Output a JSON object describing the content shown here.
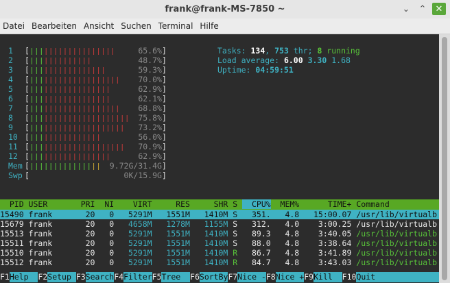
{
  "window": {
    "title": "frank@frank-MS-7850 ~",
    "buttons": {
      "minimize": "⌄",
      "maximize": "⌃",
      "close": "✕"
    }
  },
  "menu": [
    "Datei",
    "Bearbeiten",
    "Ansicht",
    "Suchen",
    "Terminal",
    "Hilfe"
  ],
  "cpus": [
    {
      "id": "1",
      "pct": "65.6%",
      "load": 0.656
    },
    {
      "id": "2",
      "pct": "48.7%",
      "load": 0.487
    },
    {
      "id": "3",
      "pct": "59.3%",
      "load": 0.593
    },
    {
      "id": "4",
      "pct": "70.0%",
      "load": 0.7
    },
    {
      "id": "5",
      "pct": "62.9%",
      "load": 0.629
    },
    {
      "id": "6",
      "pct": "62.1%",
      "load": 0.621
    },
    {
      "id": "7",
      "pct": "68.8%",
      "load": 0.688
    },
    {
      "id": "8",
      "pct": "75.8%",
      "load": 0.758
    },
    {
      "id": "9",
      "pct": "73.2%",
      "load": 0.732
    },
    {
      "id": "10",
      "pct": "56.0%",
      "load": 0.56
    },
    {
      "id": "11",
      "pct": "70.9%",
      "load": 0.709
    },
    {
      "id": "12",
      "pct": "62.9%",
      "load": 0.629
    }
  ],
  "mem": {
    "label": "Mem",
    "value": "9.72G/31.4G",
    "load": 0.55
  },
  "swp": {
    "label": "Swp",
    "value": "0K/15.9G",
    "load": 0
  },
  "summary": {
    "tasks_label": "Tasks: ",
    "tasks": "134",
    "threads": "753",
    "thr_label": " thr; ",
    "running": "8",
    "running_label": " running",
    "load_label": "Load average: ",
    "load1": "6.00",
    "load5": "3.30",
    "load15": "1.68",
    "uptime_label": "Uptime: ",
    "uptime": "04:59:51"
  },
  "columns": [
    "PID",
    "USER",
    "PRI",
    "NI",
    "VIRT",
    "RES",
    "SHR",
    "S",
    "CPU%",
    "MEM%",
    "TIME+",
    "Command"
  ],
  "processes": [
    {
      "pid": "15490",
      "user": "frank",
      "pri": "20",
      "ni": "0",
      "virt": "5291M",
      "res": "1551M",
      "shr": "1410M",
      "s": "S",
      "cpu": "351.",
      "mem": "4.8",
      "time": "15:00.07",
      "cmd": "/usr/lib/virtualb",
      "selected": true
    },
    {
      "pid": "15679",
      "user": "frank",
      "pri": "20",
      "ni": "0",
      "virt": "4658M",
      "res": "1278M",
      "shr": "1155M",
      "s": "S",
      "cpu": "312.",
      "mem": "4.0",
      "time": "3:00.25",
      "cmd": "/usr/lib/virtualb",
      "selected": false
    },
    {
      "pid": "15513",
      "user": "frank",
      "pri": "20",
      "ni": "0",
      "virt": "5291M",
      "res": "1551M",
      "shr": "1410M",
      "s": "S",
      "cpu": "89.3",
      "mem": "4.8",
      "time": "3:40.05",
      "cmd": "/usr/lib/virtualb",
      "selected": false
    },
    {
      "pid": "15511",
      "user": "frank",
      "pri": "20",
      "ni": "0",
      "virt": "5291M",
      "res": "1551M",
      "shr": "1410M",
      "s": "S",
      "cpu": "88.0",
      "mem": "4.8",
      "time": "3:38.64",
      "cmd": "/usr/lib/virtualb",
      "selected": false
    },
    {
      "pid": "15510",
      "user": "frank",
      "pri": "20",
      "ni": "0",
      "virt": "5291M",
      "res": "1551M",
      "shr": "1410M",
      "s": "R",
      "cpu": "86.7",
      "mem": "4.8",
      "time": "3:41.89",
      "cmd": "/usr/lib/virtualb",
      "selected": false
    },
    {
      "pid": "15512",
      "user": "frank",
      "pri": "20",
      "ni": "0",
      "virt": "5291M",
      "res": "1551M",
      "shr": "1410M",
      "s": "R",
      "cpu": "84.7",
      "mem": "4.8",
      "time": "3:43.03",
      "cmd": "/usr/lib/virtualb",
      "selected": false
    }
  ],
  "fkeys": [
    {
      "key": "F1",
      "label": "Help  "
    },
    {
      "key": "F2",
      "label": "Setup "
    },
    {
      "key": "F3",
      "label": "Search"
    },
    {
      "key": "F4",
      "label": "Filter"
    },
    {
      "key": "F5",
      "label": "Tree  "
    },
    {
      "key": "F6",
      "label": "SortBy"
    },
    {
      "key": "F7",
      "label": "Nice -"
    },
    {
      "key": "F8",
      "label": "Nice +"
    },
    {
      "key": "F9",
      "label": "Kill  "
    },
    {
      "key": "F10",
      "label": "Quit"
    }
  ],
  "colors": {
    "green": "#58c23a",
    "red": "#c43a3a",
    "cyan": "#3fb2c3",
    "yellow": "#c8a433"
  }
}
